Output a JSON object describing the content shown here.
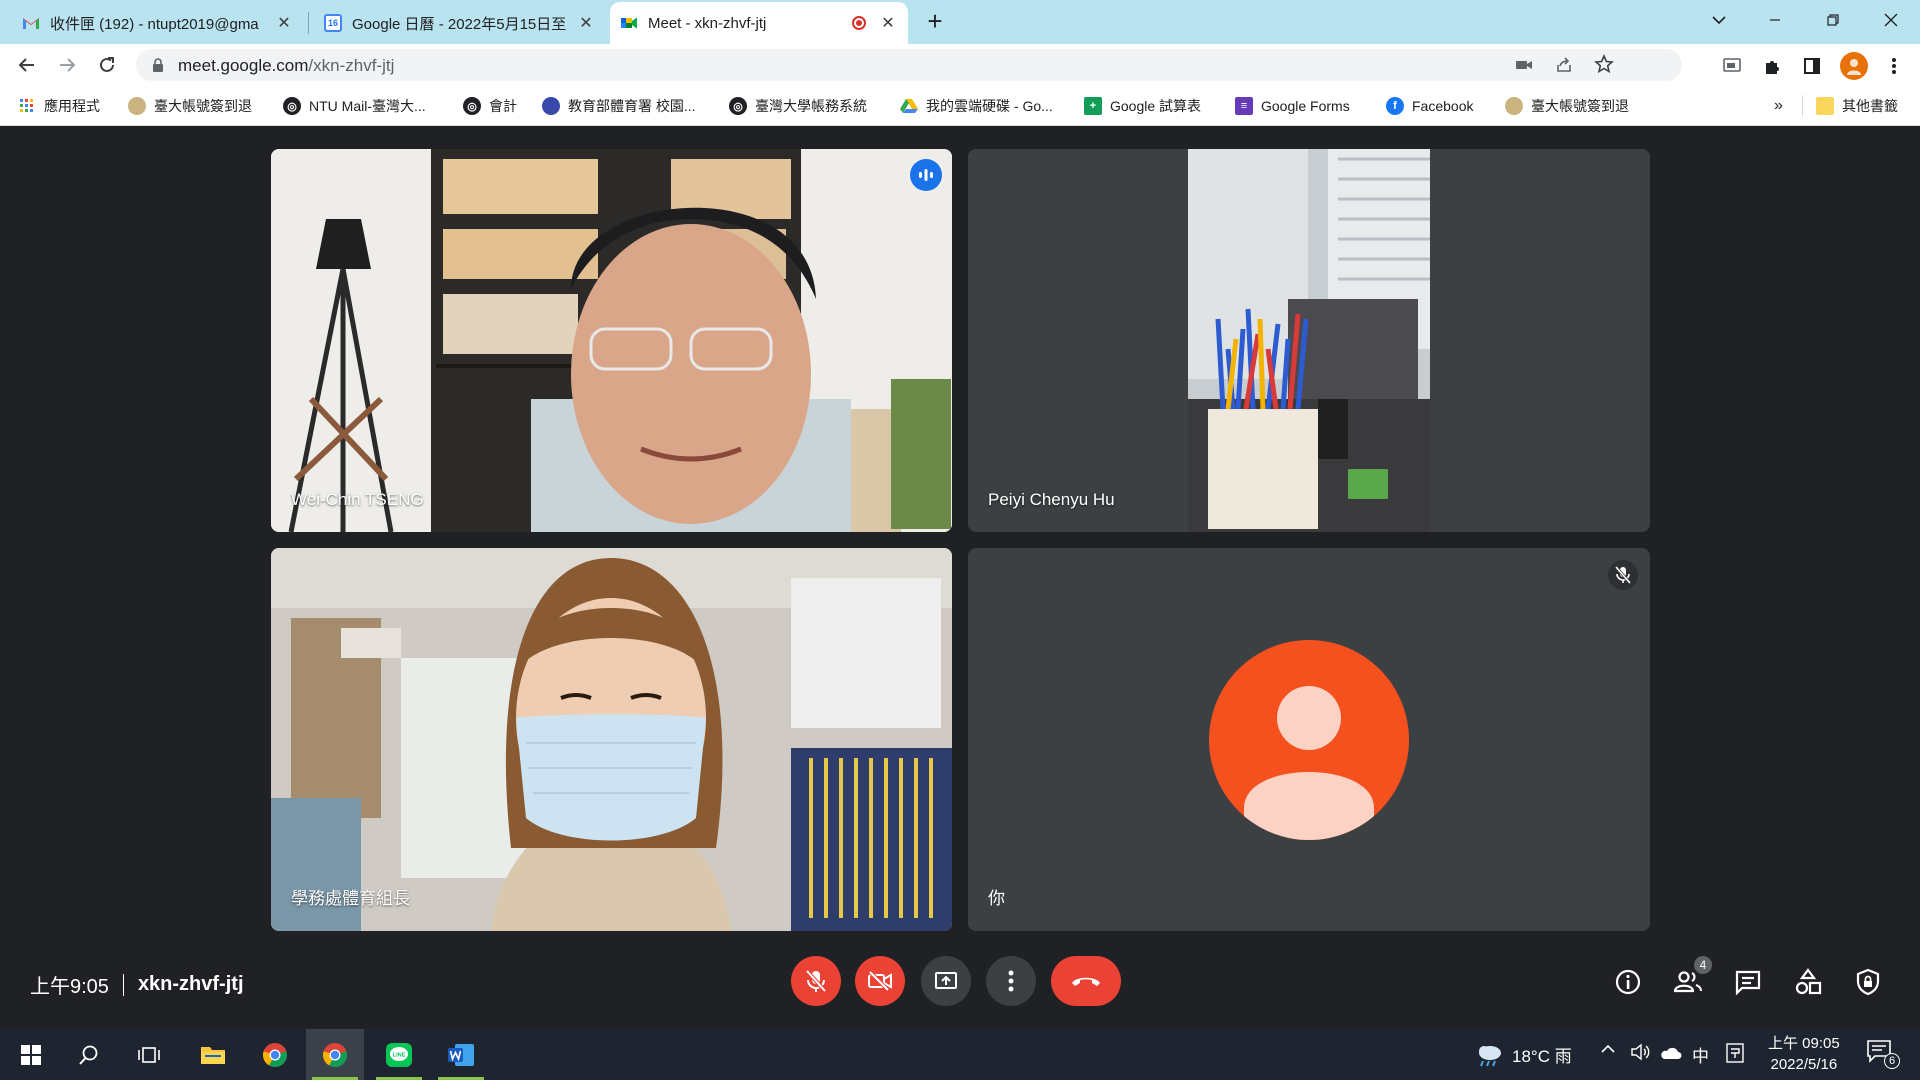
{
  "browser": {
    "tabs": [
      {
        "title": "收件匣 (192) - ntupt2019@gma",
        "favicon": "gmail-icon"
      },
      {
        "title": "Google 日曆 - 2022年5月15日至",
        "favicon": "calendar-icon",
        "favicon_text": "16"
      },
      {
        "title": "Meet - xkn-zhvf-jtj",
        "favicon": "meet-icon",
        "active": true
      }
    ],
    "url_host": "meet.google.com",
    "url_path": "/xkn-zhvf-jtj",
    "bookmarks": [
      {
        "label": "應用程式",
        "icon": "apps-grid-icon"
      },
      {
        "label": "臺大帳號簽到退",
        "icon": "ntu-seal-icon"
      },
      {
        "label": "NTU Mail-臺灣大...",
        "icon": "globe-icon"
      },
      {
        "label": "會計",
        "icon": "globe-icon"
      },
      {
        "label": "教育部體育署 校園...",
        "icon": "moe-icon"
      },
      {
        "label": "臺灣大學帳務系統",
        "icon": "globe-icon"
      },
      {
        "label": "我的雲端硬碟 - Go...",
        "icon": "drive-icon"
      },
      {
        "label": "Google 試算表",
        "icon": "sheets-icon"
      },
      {
        "label": "Google Forms",
        "icon": "forms-icon"
      },
      {
        "label": "Facebook",
        "icon": "facebook-icon"
      },
      {
        "label": "臺大帳號簽到退",
        "icon": "ntu-seal-icon"
      }
    ],
    "bookmarks_overflow": "»",
    "other_bookmarks": "其他書籤"
  },
  "meet": {
    "participants": [
      {
        "name": "Wei-Chin TSENG",
        "speaking": true
      },
      {
        "name": "Peiyi Chenyu Hu"
      },
      {
        "name": "學務處體育組長"
      },
      {
        "name": "你",
        "muted": true,
        "avatar_color": "#f4511e"
      }
    ],
    "time": "上午9:05",
    "meeting_code": "xkn-zhvf-jtj",
    "people_count": "4"
  },
  "taskbar": {
    "weather": "18°C 雨",
    "ime": "中",
    "time": "上午 09:05",
    "date": "2022/5/16",
    "notification_count": "6"
  }
}
